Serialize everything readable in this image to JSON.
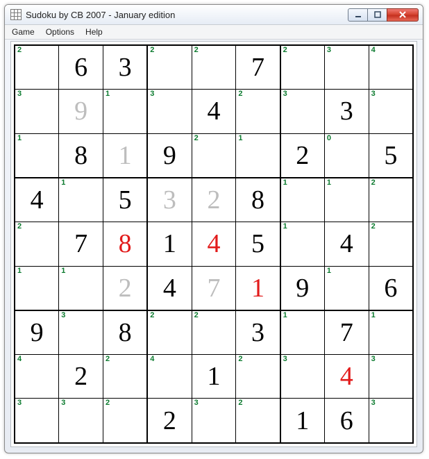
{
  "window": {
    "title": "Sudoku by CB 2007 - January edition"
  },
  "menubar": {
    "game": "Game",
    "options": "Options",
    "help": "Help"
  },
  "board": {
    "cells": [
      [
        {
          "hint": "2",
          "value": "",
          "style": "black"
        },
        {
          "hint": "",
          "value": "6",
          "style": "black"
        },
        {
          "hint": "",
          "value": "3",
          "style": "black"
        },
        {
          "hint": "2",
          "value": "",
          "style": "black"
        },
        {
          "hint": "2",
          "value": "",
          "style": "black"
        },
        {
          "hint": "",
          "value": "7",
          "style": "black"
        },
        {
          "hint": "2",
          "value": "",
          "style": "black"
        },
        {
          "hint": "3",
          "value": "",
          "style": "black"
        },
        {
          "hint": "4",
          "value": "",
          "style": "black"
        }
      ],
      [
        {
          "hint": "3",
          "value": "",
          "style": "black"
        },
        {
          "hint": "",
          "value": "9",
          "style": "gray"
        },
        {
          "hint": "1",
          "value": "",
          "style": "black"
        },
        {
          "hint": "3",
          "value": "",
          "style": "black"
        },
        {
          "hint": "",
          "value": "4",
          "style": "black"
        },
        {
          "hint": "2",
          "value": "",
          "style": "black"
        },
        {
          "hint": "3",
          "value": "",
          "style": "black"
        },
        {
          "hint": "",
          "value": "3",
          "style": "black"
        },
        {
          "hint": "3",
          "value": "",
          "style": "black"
        }
      ],
      [
        {
          "hint": "1",
          "value": "",
          "style": "black"
        },
        {
          "hint": "",
          "value": "8",
          "style": "black"
        },
        {
          "hint": "",
          "value": "1",
          "style": "gray"
        },
        {
          "hint": "",
          "value": "9",
          "style": "black"
        },
        {
          "hint": "2",
          "value": "",
          "style": "black"
        },
        {
          "hint": "1",
          "value": "",
          "style": "black"
        },
        {
          "hint": "",
          "value": "2",
          "style": "black"
        },
        {
          "hint": "0",
          "value": "",
          "style": "black"
        },
        {
          "hint": "",
          "value": "5",
          "style": "black"
        }
      ],
      [
        {
          "hint": "",
          "value": "4",
          "style": "black"
        },
        {
          "hint": "1",
          "value": "",
          "style": "black"
        },
        {
          "hint": "",
          "value": "5",
          "style": "black"
        },
        {
          "hint": "",
          "value": "3",
          "style": "gray"
        },
        {
          "hint": "",
          "value": "2",
          "style": "gray"
        },
        {
          "hint": "",
          "value": "8",
          "style": "black"
        },
        {
          "hint": "1",
          "value": "",
          "style": "black"
        },
        {
          "hint": "1",
          "value": "",
          "style": "black"
        },
        {
          "hint": "2",
          "value": "",
          "style": "black"
        }
      ],
      [
        {
          "hint": "2",
          "value": "",
          "style": "black"
        },
        {
          "hint": "",
          "value": "7",
          "style": "black"
        },
        {
          "hint": "",
          "value": "8",
          "style": "red"
        },
        {
          "hint": "",
          "value": "1",
          "style": "black"
        },
        {
          "hint": "",
          "value": "4",
          "style": "red"
        },
        {
          "hint": "",
          "value": "5",
          "style": "black"
        },
        {
          "hint": "1",
          "value": "",
          "style": "black"
        },
        {
          "hint": "",
          "value": "4",
          "style": "black"
        },
        {
          "hint": "2",
          "value": "",
          "style": "black"
        }
      ],
      [
        {
          "hint": "1",
          "value": "",
          "style": "black"
        },
        {
          "hint": "1",
          "value": "",
          "style": "black"
        },
        {
          "hint": "",
          "value": "2",
          "style": "gray"
        },
        {
          "hint": "",
          "value": "4",
          "style": "black"
        },
        {
          "hint": "",
          "value": "7",
          "style": "gray"
        },
        {
          "hint": "",
          "value": "1",
          "style": "red"
        },
        {
          "hint": "",
          "value": "9",
          "style": "black"
        },
        {
          "hint": "1",
          "value": "",
          "style": "black"
        },
        {
          "hint": "",
          "value": "6",
          "style": "black"
        }
      ],
      [
        {
          "hint": "",
          "value": "9",
          "style": "black"
        },
        {
          "hint": "3",
          "value": "",
          "style": "black"
        },
        {
          "hint": "",
          "value": "8",
          "style": "black"
        },
        {
          "hint": "2",
          "value": "",
          "style": "black"
        },
        {
          "hint": "2",
          "value": "",
          "style": "black"
        },
        {
          "hint": "",
          "value": "3",
          "style": "black"
        },
        {
          "hint": "1",
          "value": "",
          "style": "black"
        },
        {
          "hint": "",
          "value": "7",
          "style": "black"
        },
        {
          "hint": "1",
          "value": "",
          "style": "black"
        }
      ],
      [
        {
          "hint": "4",
          "value": "",
          "style": "black"
        },
        {
          "hint": "",
          "value": "2",
          "style": "black"
        },
        {
          "hint": "2",
          "value": "",
          "style": "black"
        },
        {
          "hint": "4",
          "value": "",
          "style": "black"
        },
        {
          "hint": "",
          "value": "1",
          "style": "black"
        },
        {
          "hint": "2",
          "value": "",
          "style": "black"
        },
        {
          "hint": "3",
          "value": "",
          "style": "black"
        },
        {
          "hint": "",
          "value": "4",
          "style": "red"
        },
        {
          "hint": "3",
          "value": "",
          "style": "black"
        }
      ],
      [
        {
          "hint": "3",
          "value": "",
          "style": "black"
        },
        {
          "hint": "3",
          "value": "",
          "style": "black"
        },
        {
          "hint": "2",
          "value": "",
          "style": "black"
        },
        {
          "hint": "",
          "value": "2",
          "style": "black"
        },
        {
          "hint": "3",
          "value": "",
          "style": "black"
        },
        {
          "hint": "2",
          "value": "",
          "style": "black"
        },
        {
          "hint": "",
          "value": "1",
          "style": "black"
        },
        {
          "hint": "",
          "value": "6",
          "style": "black"
        },
        {
          "hint": "3",
          "value": "",
          "style": "black"
        }
      ]
    ]
  }
}
